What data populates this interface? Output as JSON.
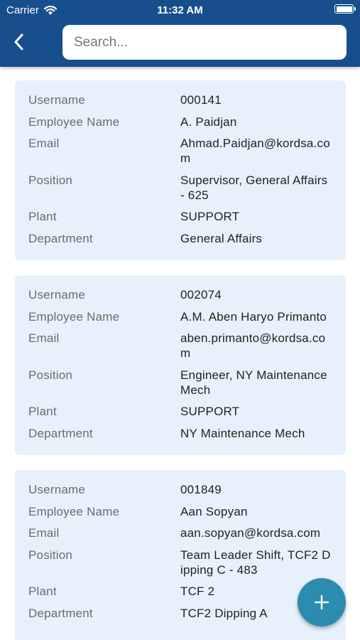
{
  "status_bar": {
    "carrier": "Carrier",
    "time": "11:32 AM"
  },
  "header": {
    "back_icon": "chevron-left-icon",
    "search_placeholder": "Search...",
    "search_value": ""
  },
  "labels": {
    "username": "Username",
    "employee_name": "Employee Name",
    "email": "Email",
    "position": "Position",
    "plant": "Plant",
    "department": "Department"
  },
  "employees": [
    {
      "username": "000141",
      "employee_name": "A. Paidjan",
      "email": "Ahmad.Paidjan@kordsa.com",
      "position": "Supervisor, General Affairs - 625",
      "plant": "SUPPORT",
      "department": "General Affairs"
    },
    {
      "username": "002074",
      "employee_name": "A.M. Aben Haryo Primanto",
      "email": "aben.primanto@kordsa.com",
      "position": "Engineer, NY Maintenance Mech",
      "plant": "SUPPORT",
      "department": "NY Maintenance Mech"
    },
    {
      "username": "001849",
      "employee_name": "Aan Sopyan",
      "email": "aan.sopyan@kordsa.com",
      "position": "Team Leader Shift, TCF2 Dipping C - 483",
      "plant": "TCF 2",
      "department": "TCF2 Dipping A"
    }
  ],
  "fab": {
    "icon": "plus-icon"
  },
  "colors": {
    "header": "#164f8c",
    "card": "#e8f1fb",
    "fab": "#2b8cb0"
  }
}
